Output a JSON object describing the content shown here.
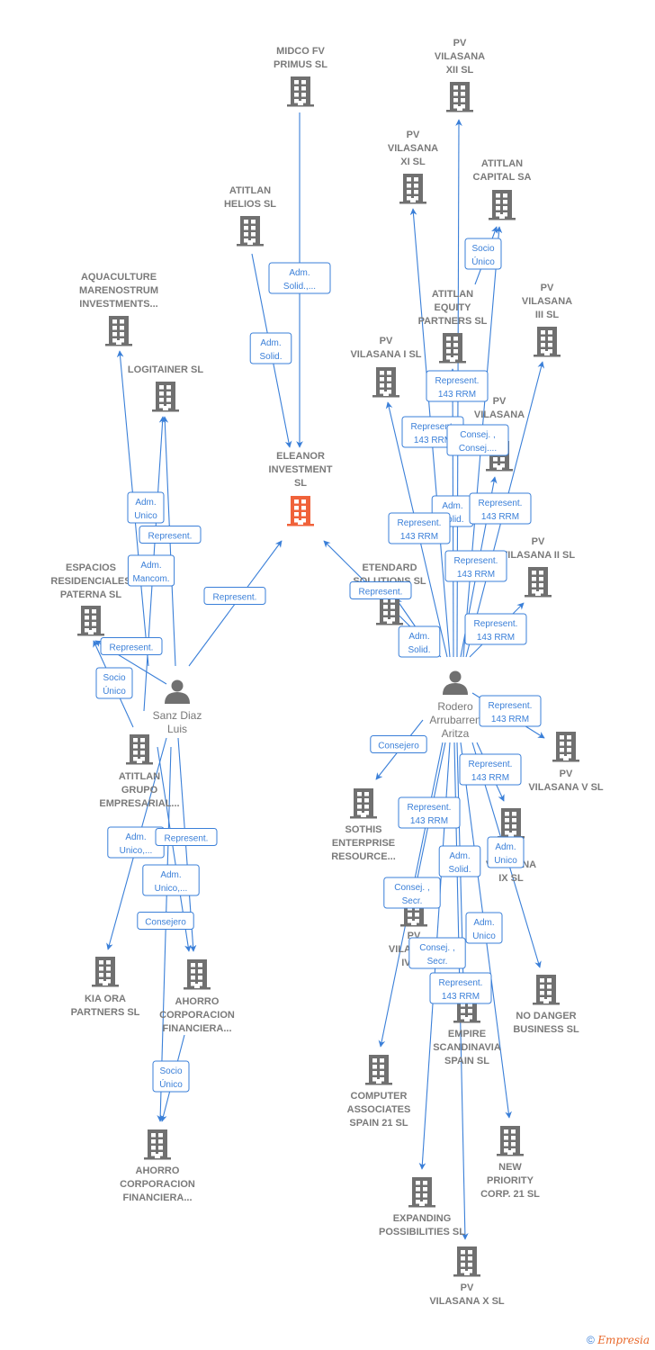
{
  "colors": {
    "edge": "#3a7fd8",
    "building": "#707070",
    "focus_building": "#f0623a",
    "person": "#707070",
    "label": "#7a7a7a"
  },
  "nodes": {
    "midco": {
      "type": "company",
      "lines": [
        "MIDCO FV",
        "PRIMUS  SL"
      ]
    },
    "pv12": {
      "type": "company",
      "lines": [
        "PV",
        "VILASANA",
        "XII SL"
      ]
    },
    "pv11": {
      "type": "company",
      "lines": [
        "PV",
        "VILASANA",
        "XI SL"
      ]
    },
    "atitlan_capital": {
      "type": "company",
      "lines": [
        "ATITLAN",
        "CAPITAL SA"
      ]
    },
    "atitlan_helios": {
      "type": "company",
      "lines": [
        "ATITLAN",
        "HELIOS  SL"
      ]
    },
    "aquaculture": {
      "type": "company",
      "lines": [
        "AQUACULTURE",
        "MARENOSTRUM",
        "INVESTMENTS..."
      ]
    },
    "logitainer": {
      "type": "company",
      "lines": [
        "LOGITAINER SL"
      ]
    },
    "atitlan_equity": {
      "type": "company",
      "lines": [
        "ATITLAN",
        "EQUITY",
        "PARTNERS SL"
      ]
    },
    "pv3": {
      "type": "company",
      "lines": [
        "PV",
        "VILASANA",
        "III SL"
      ]
    },
    "pv1": {
      "type": "company",
      "lines": [
        "PV",
        "VILASANA I SL"
      ]
    },
    "pvx": {
      "type": "company",
      "lines": [
        "PV",
        "VILASANA",
        "SL"
      ]
    },
    "eleanor": {
      "type": "focus",
      "lines": [
        "ELEANOR",
        "INVESTMENT",
        "SL"
      ]
    },
    "espacios": {
      "type": "company",
      "lines": [
        "ESPACIOS",
        "RESIDENCIALES",
        "PATERNA  SL"
      ]
    },
    "etendard": {
      "type": "company",
      "lines": [
        "ETENDARD",
        "SOLUTIONS SL"
      ]
    },
    "pv2": {
      "type": "company",
      "lines": [
        "PV",
        "VILASANA II SL"
      ]
    },
    "sanz": {
      "type": "person",
      "lines": [
        "Sanz Diaz",
        "Luis"
      ]
    },
    "rodero": {
      "type": "person",
      "lines": [
        "Rodero",
        "Arrubarren",
        "Aritza"
      ]
    },
    "atitlan_grupo": {
      "type": "company",
      "lines": [
        "ATITLAN",
        "GRUPO",
        "EMPRESARIAL..."
      ]
    },
    "pv5": {
      "type": "company",
      "lines": [
        "PV",
        "VILASANA V SL"
      ]
    },
    "sothis": {
      "type": "company",
      "lines": [
        "SOTHIS",
        "ENTERPRISE",
        "RESOURCE..."
      ]
    },
    "pv9": {
      "type": "company",
      "lines": [
        "PV",
        "VILASANA",
        "IX SL"
      ]
    },
    "pv4": {
      "type": "company",
      "lines": [
        "PV",
        "VILASANA",
        "IV SL"
      ]
    },
    "kia": {
      "type": "company",
      "lines": [
        "KIA ORA",
        "PARTNERS  SL"
      ]
    },
    "ahorro1": {
      "type": "company",
      "lines": [
        "AHORRO",
        "CORPORACION",
        "FINANCIERA..."
      ]
    },
    "nodanger": {
      "type": "company",
      "lines": [
        "NO DANGER",
        "BUSINESS SL"
      ]
    },
    "empire": {
      "type": "company",
      "lines": [
        "EMPIRE",
        "SCANDINAVIA",
        "SPAIN SL"
      ]
    },
    "computer": {
      "type": "company",
      "lines": [
        "COMPUTER",
        "ASSOCIATES",
        "SPAIN 21 SL"
      ]
    },
    "ahorro2": {
      "type": "company",
      "lines": [
        "AHORRO",
        "CORPORACION",
        "FINANCIERA..."
      ]
    },
    "newpriority": {
      "type": "company",
      "lines": [
        "NEW",
        "PRIORITY",
        "CORP.  21 SL"
      ]
    },
    "expanding": {
      "type": "company",
      "lines": [
        "EXPANDING",
        "POSSIBILITIES SL"
      ]
    },
    "pv10": {
      "type": "company",
      "lines": [
        "PV",
        "VILASANA X SL"
      ]
    }
  },
  "edges": [
    {
      "from": "midco",
      "to": "eleanor",
      "label": [
        "Adm.",
        "Solid.,..."
      ]
    },
    {
      "from": "atitlan_helios",
      "to": "eleanor",
      "label": [
        "Adm.",
        "Solid."
      ]
    },
    {
      "from": "sanz",
      "to": "eleanor",
      "label": [
        "Represent."
      ]
    },
    {
      "from": "sanz",
      "to": "aquaculture",
      "label": [
        "Adm.",
        "Unico"
      ]
    },
    {
      "from": "sanz",
      "to": "logitainer",
      "label": [
        "Represent."
      ]
    },
    {
      "from": "sanz",
      "to": "logitainer",
      "label": [
        "Adm.",
        "Mancom."
      ]
    },
    {
      "from": "sanz",
      "to": "espacios",
      "label": [
        "Represent."
      ]
    },
    {
      "from": "atitlan_grupo",
      "to": "espacios",
      "label": [
        "Socio",
        "Único"
      ]
    },
    {
      "from": "sanz",
      "to": "kia",
      "label": [
        "Adm.",
        "Unico,..."
      ]
    },
    {
      "from": "sanz",
      "to": "ahorro1",
      "label": [
        "Represent."
      ]
    },
    {
      "from": "sanz",
      "to": "ahorro1",
      "label": [
        "Adm.",
        "Unico,..."
      ]
    },
    {
      "from": "sanz",
      "to": "ahorro2",
      "label": [
        "Consejero"
      ]
    },
    {
      "from": "ahorro1",
      "to": "ahorro2",
      "label": [
        "Socio",
        "Único"
      ]
    },
    {
      "from": "rodero",
      "to": "eleanor",
      "label": [
        "Represent."
      ]
    },
    {
      "from": "rodero",
      "to": "etendard",
      "label": [
        "Adm.",
        "Solid."
      ]
    },
    {
      "from": "rodero",
      "to": "pv12",
      "label": [
        "Represent.",
        "143 RRM"
      ]
    },
    {
      "from": "rodero",
      "to": "pv11",
      "label": [
        "Represent.",
        "143 RRM"
      ]
    },
    {
      "from": "rodero",
      "to": "atitlan_capital",
      "label": [
        "Consej. ,",
        "Consej...."
      ]
    },
    {
      "from": "atitlan_equity",
      "to": "atitlan_capital",
      "label": [
        "Socio",
        "Único"
      ]
    },
    {
      "from": "rodero",
      "to": "atitlan_equity",
      "label": [
        "Adm.",
        "Solid."
      ]
    },
    {
      "from": "rodero",
      "to": "pv1",
      "label": [
        "Represent.",
        "143 RRM"
      ]
    },
    {
      "from": "rodero",
      "to": "pvx",
      "label": [
        "Represent.",
        "143 RRM"
      ]
    },
    {
      "from": "rodero",
      "to": "pv3",
      "label": [
        "Represent.",
        "143 RRM"
      ]
    },
    {
      "from": "rodero",
      "to": "pv2",
      "label": [
        "Represent.",
        "143 RRM"
      ]
    },
    {
      "from": "rodero",
      "to": "pv5",
      "label": [
        "Represent.",
        "143 RRM"
      ]
    },
    {
      "from": "rodero",
      "to": "pv9",
      "label": [
        "Represent.",
        "143 RRM"
      ]
    },
    {
      "from": "rodero",
      "to": "sothis",
      "label": [
        "Consejero"
      ]
    },
    {
      "from": "rodero",
      "to": "pv4",
      "label": [
        "Represent.",
        "143 RRM"
      ]
    },
    {
      "from": "rodero",
      "to": "computer",
      "label": [
        "Consej. ,",
        "Secr."
      ]
    },
    {
      "from": "rodero",
      "to": "nodanger",
      "label": [
        "Adm.",
        "Unico"
      ]
    },
    {
      "from": "rodero",
      "to": "expanding",
      "label": [
        "Adm.",
        "Solid."
      ]
    },
    {
      "from": "rodero",
      "to": "newpriority",
      "label": [
        "Adm.",
        "Unico"
      ]
    },
    {
      "from": "rodero",
      "to": "pv10",
      "label": [
        "Consej. ,",
        "Secr."
      ]
    },
    {
      "from": "rodero",
      "to": "empire",
      "label": [
        "Represent.",
        "143 RRM"
      ]
    }
  ],
  "footer": {
    "copyright": "©",
    "brand": "Empresia"
  }
}
